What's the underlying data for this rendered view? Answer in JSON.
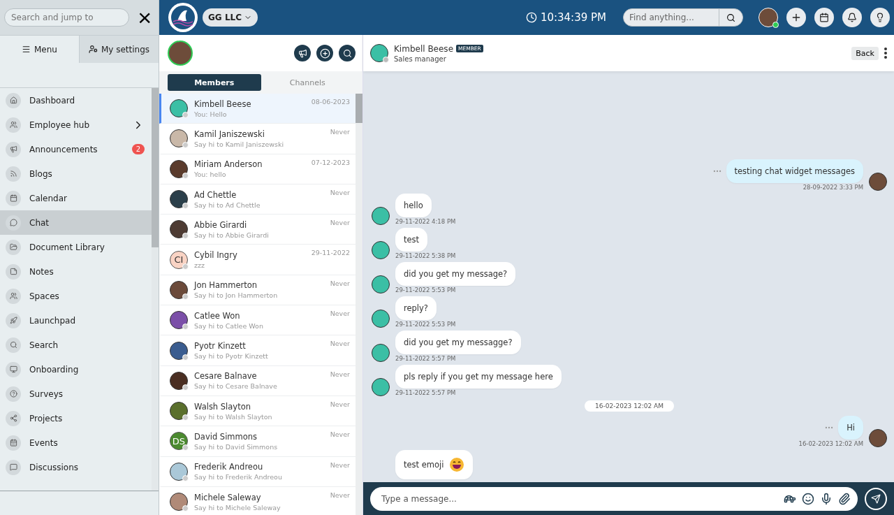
{
  "sidebar": {
    "search": {
      "placeholder": "Search and jump to"
    },
    "close": "×",
    "tabs": [
      {
        "label": "Menu",
        "selected": true
      },
      {
        "label": "My settings",
        "selected": false
      }
    ],
    "items": [
      {
        "label": "Dashboard",
        "selected": false
      },
      {
        "label": "Employee hub",
        "selected": false,
        "expandable": true
      },
      {
        "label": "Announcements",
        "selected": false,
        "badge": "2"
      },
      {
        "label": "Blogs",
        "selected": false
      },
      {
        "label": "Calendar",
        "selected": false
      },
      {
        "label": "Chat",
        "selected": true
      },
      {
        "label": "Document Library",
        "selected": false
      },
      {
        "label": "Notes",
        "selected": false
      },
      {
        "label": "Spaces",
        "selected": false
      },
      {
        "label": "Launchpad",
        "selected": false
      },
      {
        "label": "Search",
        "selected": false
      },
      {
        "label": "Onboarding",
        "selected": false
      },
      {
        "label": "Surveys",
        "selected": false
      },
      {
        "label": "Projects",
        "selected": false
      },
      {
        "label": "Events",
        "selected": false
      },
      {
        "label": "Discussions",
        "selected": false
      }
    ]
  },
  "topbar": {
    "company": "GG LLC",
    "time": "10:34:39 PM",
    "search": {
      "placeholder": "Find anything..."
    }
  },
  "members_panel": {
    "tabs": [
      {
        "label": "Members",
        "selected": true
      },
      {
        "label": "Channels",
        "selected": false
      }
    ],
    "members": [
      {
        "name": "Kimbell Beese",
        "preview": "You: Hello",
        "date": "08-06-2023",
        "selected": true
      },
      {
        "name": "Kamil Janiszewski",
        "preview": "Say hi to Kamil Janiszewski",
        "date": "Never",
        "selected": false
      },
      {
        "name": "Miriam Anderson",
        "preview": "You: hello",
        "date": "07-12-2023",
        "selected": false
      },
      {
        "name": "Ad Chettle",
        "preview": "Say hi to Ad Chettle",
        "date": "Never",
        "selected": false
      },
      {
        "name": "Abbie Girardi",
        "preview": "Say hi to Abbie Girardi",
        "date": "Never",
        "selected": false
      },
      {
        "name": "Cybil Ingry",
        "preview": "zzz",
        "date": "29-11-2022",
        "selected": false,
        "initials": "CI",
        "color": "#f9d3c4"
      },
      {
        "name": "Jon Hammerton",
        "preview": "Say hi to Jon Hammerton",
        "date": "Never",
        "selected": false
      },
      {
        "name": "Catlee Won",
        "preview": "Say hi to Catlee Won",
        "date": "Never",
        "selected": false
      },
      {
        "name": "Pyotr Kinzett",
        "preview": "Say hi to Pyotr Kinzett",
        "date": "Never",
        "selected": false
      },
      {
        "name": "Cesare Balnave",
        "preview": "Say hi to Cesare Balnave",
        "date": "Never",
        "selected": false
      },
      {
        "name": "Walsh Slayton",
        "preview": "Say hi to Walsh Slayton",
        "date": "Never",
        "selected": false
      },
      {
        "name": "David Simmons",
        "preview": "Say hi to David Simmons",
        "date": "Never",
        "selected": false,
        "initials": "DS",
        "color": "#4b8a2f"
      },
      {
        "name": "Frederik Andreou",
        "preview": "Say hi to Frederik Andreou",
        "date": "Never",
        "selected": false
      },
      {
        "name": "Michele Saleway",
        "preview": "Say hi to Michele Saleway",
        "date": "Never",
        "selected": false
      }
    ]
  },
  "chat": {
    "contact": {
      "name": "Kimbell Beese",
      "role_badge": "MEMBER",
      "title": "Sales manager"
    },
    "back": "Back",
    "messages": [
      {
        "kind": "outgoing",
        "text": "testing chat widget messages",
        "time": "28-09-2022 3:33 PM"
      },
      {
        "kind": "incoming",
        "text": "hello",
        "time": "29-11-2022 4:18 PM"
      },
      {
        "kind": "incoming",
        "text": "test",
        "time": "29-11-2022 5:38 PM"
      },
      {
        "kind": "incoming",
        "text": "did you get my message?",
        "time": "29-11-2022 5:53 PM"
      },
      {
        "kind": "incoming",
        "text": "reply?",
        "time": "29-11-2022 5:53 PM"
      },
      {
        "kind": "incoming",
        "text": "did you get my messagge?",
        "time": "29-11-2022 5:57 PM"
      },
      {
        "kind": "incoming",
        "text": "pls reply if you get my message here",
        "time": "29-11-2022 5:57 PM"
      },
      {
        "kind": "date",
        "text": "16-02-2023 12:02 AM"
      },
      {
        "kind": "outgoing",
        "text": "Hi",
        "time": "16-02-2023 12:02 AM"
      },
      {
        "kind": "incoming",
        "text": "test emoji",
        "emoji": true
      }
    ],
    "composer": {
      "placeholder": "Type a message..."
    }
  }
}
